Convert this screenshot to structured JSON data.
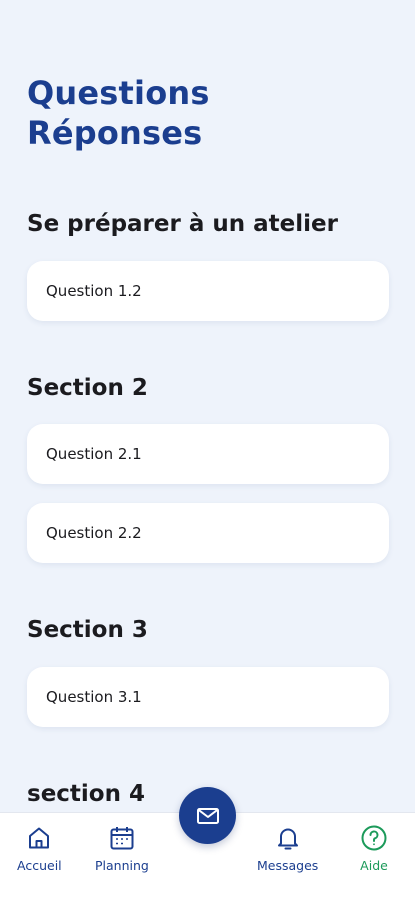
{
  "header": {
    "title_line1": "Questions",
    "title_line2": "Réponses"
  },
  "sections": [
    {
      "title": "Se préparer à un atelier",
      "questions": [
        "Question 1.2"
      ]
    },
    {
      "title": "Section 2",
      "questions": [
        "Question 2.1",
        "Question 2.2"
      ]
    },
    {
      "title": "Section 3",
      "questions": [
        "Question 3.1"
      ]
    },
    {
      "title": "section 4",
      "questions": []
    }
  ],
  "nav": {
    "items": [
      {
        "label": "Accueil",
        "icon": "home-icon"
      },
      {
        "label": "Planning",
        "icon": "calendar-icon"
      },
      {
        "label": "Messages",
        "icon": "bell-icon"
      },
      {
        "label": "Aide",
        "icon": "help-icon",
        "active": true
      }
    ],
    "fab_icon": "mail-icon"
  },
  "colors": {
    "primary": "#1b3e8f",
    "active": "#1c9a5a",
    "background": "#eef3fb",
    "card": "#ffffff"
  }
}
